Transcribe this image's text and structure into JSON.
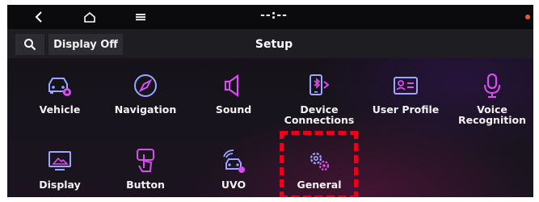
{
  "topbar": {
    "back_icon": "chevron-left-icon",
    "home_icon": "home-icon",
    "menu_icon": "menu-icon",
    "clock": "--:--"
  },
  "subbar": {
    "search_icon": "search-icon",
    "display_off_label": "Display Off",
    "title": "Setup"
  },
  "menu": {
    "items": [
      {
        "label": "Vehicle",
        "icon": "car-settings-icon"
      },
      {
        "label": "Navigation",
        "icon": "compass-icon"
      },
      {
        "label": "Sound",
        "icon": "speaker-icon"
      },
      {
        "label": "Device\nConnections",
        "icon": "phone-bluetooth-icon"
      },
      {
        "label": "User Profile",
        "icon": "id-card-icon"
      },
      {
        "label": "Voice\nRecognition",
        "icon": "microphone-icon"
      },
      {
        "label": "Display",
        "icon": "monitor-icon"
      },
      {
        "label": "Button",
        "icon": "touch-button-icon"
      },
      {
        "label": "UVO",
        "icon": "connected-car-icon"
      },
      {
        "label": "General",
        "icon": "gears-icon"
      }
    ]
  },
  "colors": {
    "accent_magenta": "#d84cf0",
    "accent_blue": "#9aa6ff",
    "highlight_red": "#e8001c"
  }
}
